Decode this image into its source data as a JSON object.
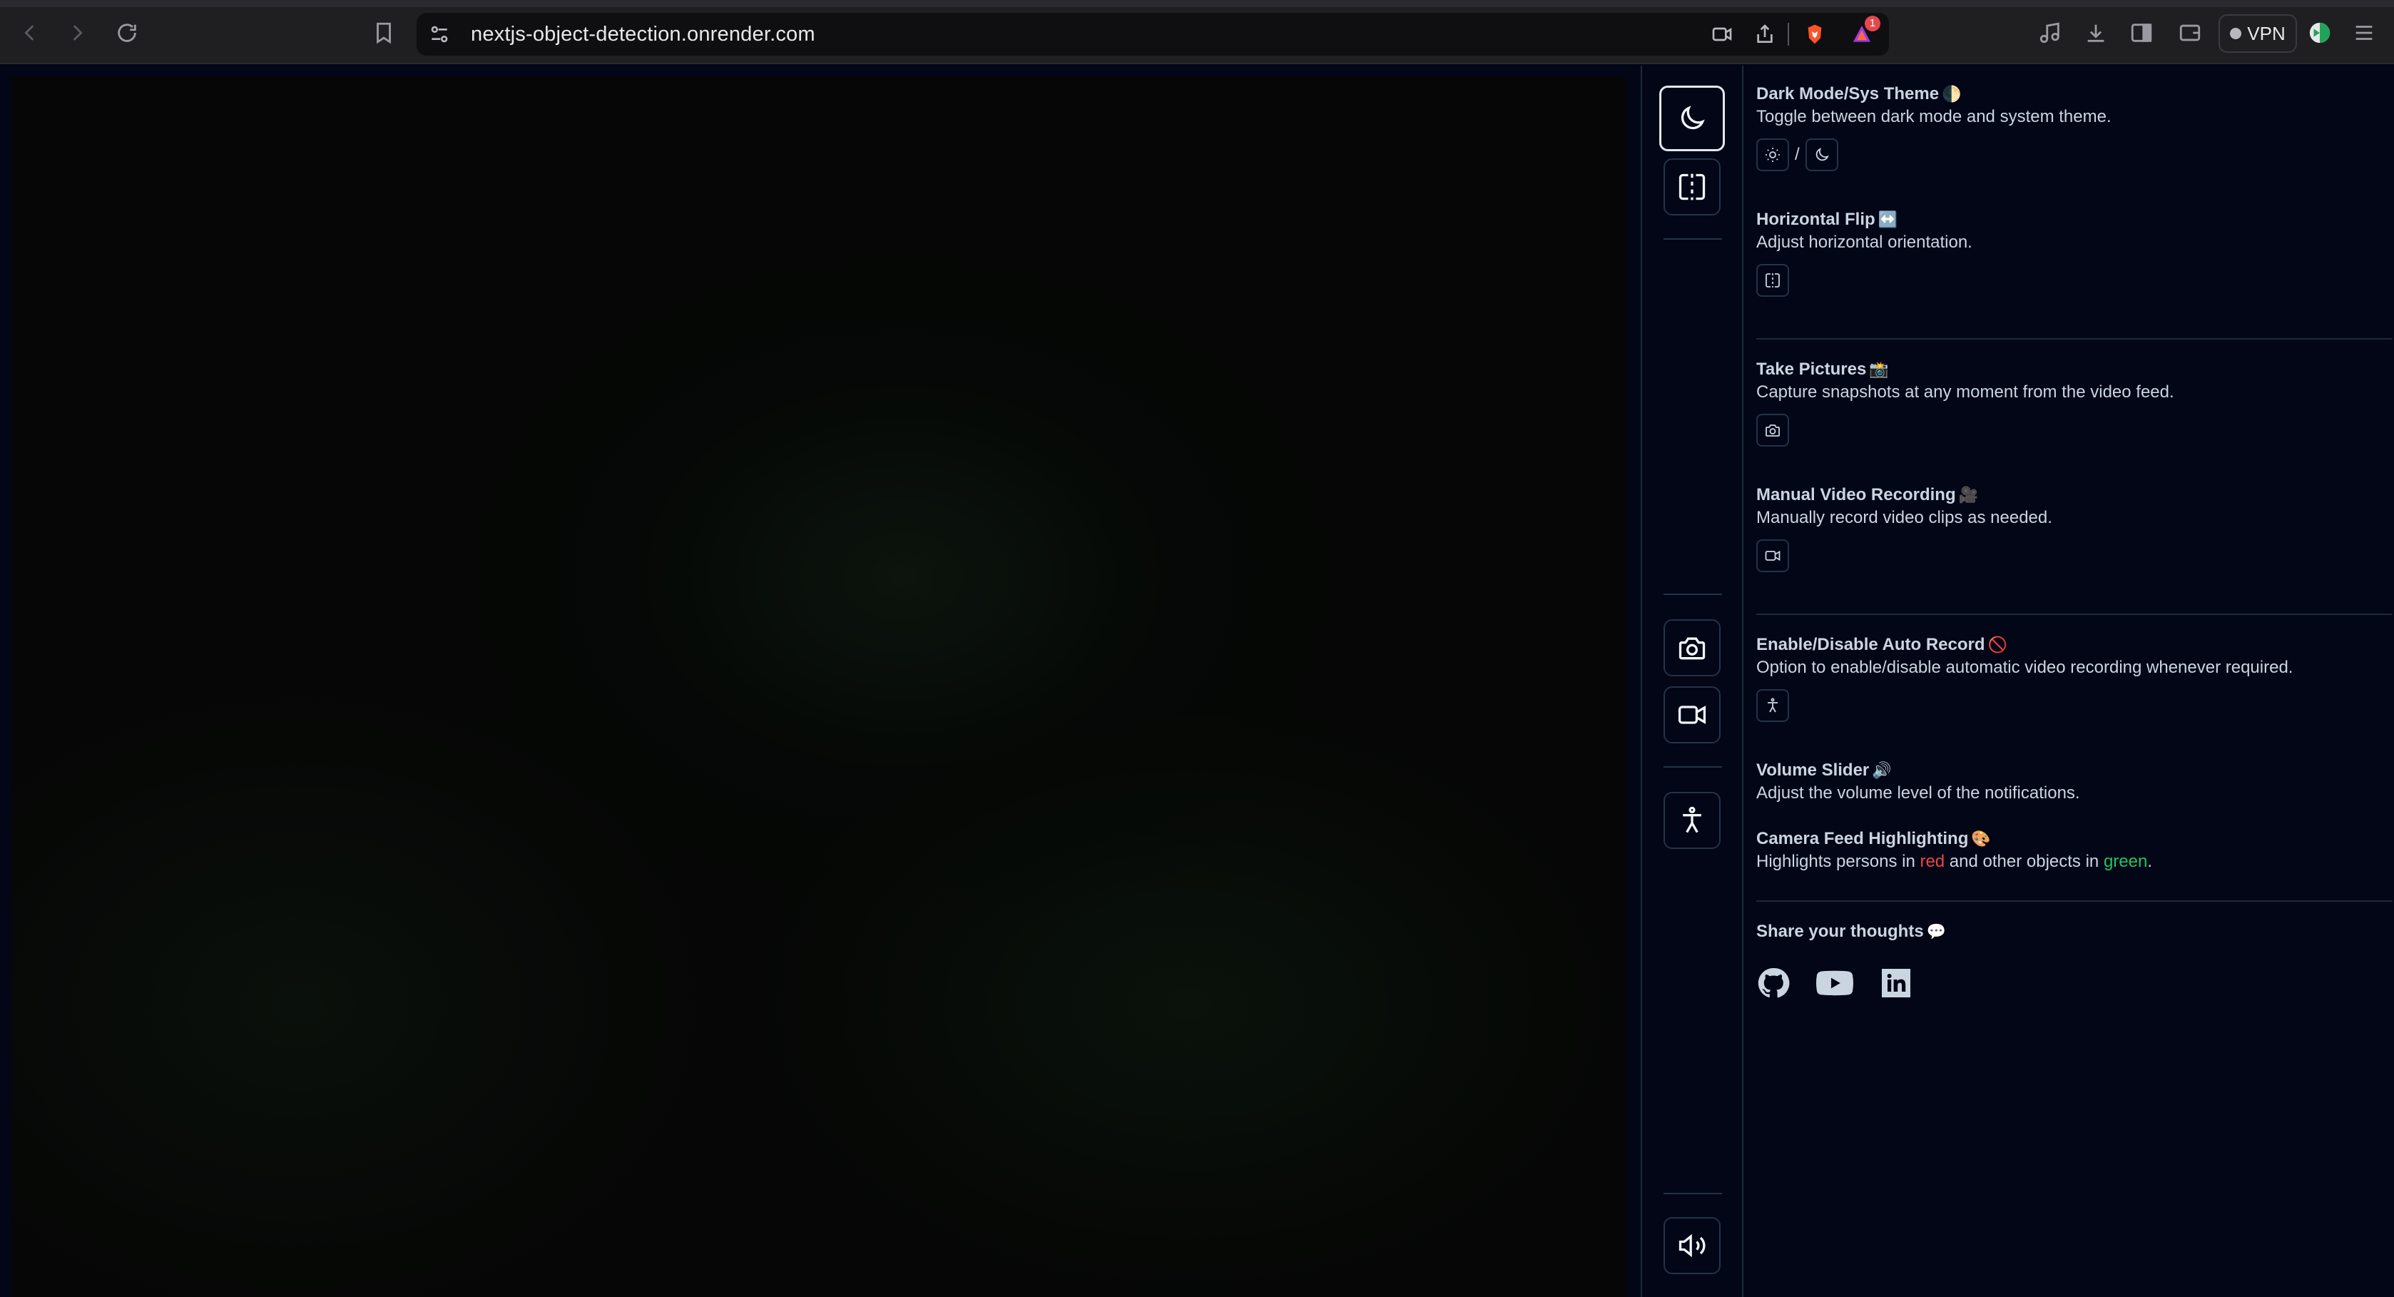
{
  "browser": {
    "url": "nextjs-object-detection.onrender.com",
    "shield_badge_count": "1",
    "vpn_label": "VPN"
  },
  "panel": {
    "dark_mode": {
      "title": "Dark Mode/Sys Theme",
      "emoji": "🌓",
      "desc": "Toggle between dark mode and system theme.",
      "separator": "/"
    },
    "flip": {
      "title": "Horizontal Flip",
      "emoji": "↔️",
      "desc": "Adjust horizontal orientation."
    },
    "pictures": {
      "title": "Take Pictures",
      "emoji": "📸",
      "desc": "Capture snapshots at any moment from the video feed."
    },
    "recording": {
      "title": "Manual Video Recording",
      "emoji": "🎥",
      "desc": "Manually record video clips as needed."
    },
    "auto_record": {
      "title": "Enable/Disable Auto Record",
      "emoji": "🚫",
      "desc": "Option to enable/disable automatic video recording whenever required."
    },
    "volume": {
      "title": "Volume Slider",
      "emoji": "🔊",
      "desc": "Adjust the volume level of the notifications."
    },
    "highlighting": {
      "title": "Camera Feed Highlighting",
      "emoji": "🎨",
      "desc_part1": "Highlights persons in ",
      "red_word": "red",
      "desc_part2": " and other objects in ",
      "green_word": "green",
      "desc_part3": "."
    },
    "share": {
      "title": "Share your thoughts",
      "emoji": "💬"
    }
  },
  "colors": {
    "person_highlight": "#ef4444",
    "object_highlight": "#22c55e",
    "background": "#020617"
  },
  "icons": {
    "toolbar": [
      "moon-icon",
      "flip-icon",
      "camera-icon",
      "video-icon",
      "accessibility-icon",
      "volume-icon"
    ],
    "social": [
      "github-icon",
      "youtube-icon",
      "linkedin-icon"
    ]
  }
}
